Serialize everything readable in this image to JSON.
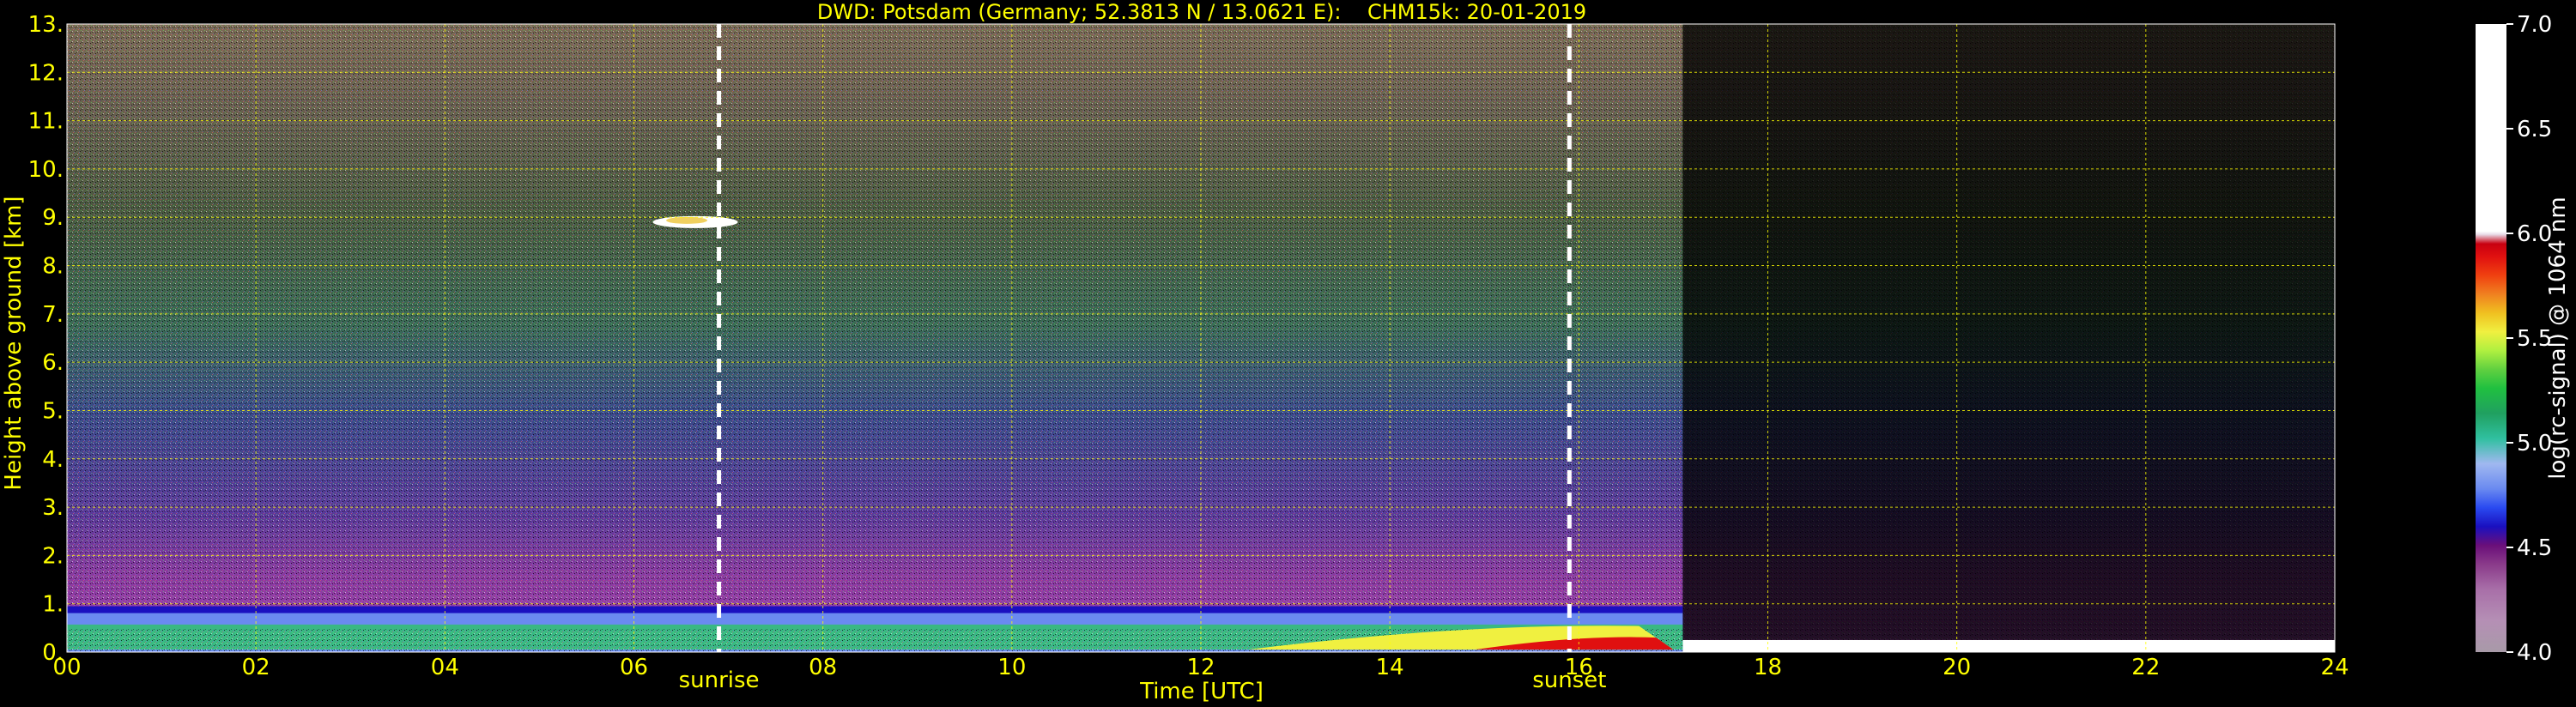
{
  "chart_data": {
    "type": "heatmap",
    "title": "DWD: Potsdam (Germany; 52.3813 N / 13.0621 E):    CHM15k: 20-01-2019",
    "xlabel": "Time [UTC]",
    "ylabel": "Height above ground [km]",
    "xlim": [
      0,
      24
    ],
    "ylim": [
      0,
      13
    ],
    "x_ticks": [
      {
        "value": 0,
        "label": "00"
      },
      {
        "value": 2,
        "label": "02"
      },
      {
        "value": 4,
        "label": "04"
      },
      {
        "value": 6,
        "label": "06"
      },
      {
        "value": 8,
        "label": "08"
      },
      {
        "value": 10,
        "label": "10"
      },
      {
        "value": 12,
        "label": "12"
      },
      {
        "value": 14,
        "label": "14"
      },
      {
        "value": 16,
        "label": "16"
      },
      {
        "value": 18,
        "label": "18"
      },
      {
        "value": 20,
        "label": "20"
      },
      {
        "value": 22,
        "label": "22"
      },
      {
        "value": 24,
        "label": "24"
      }
    ],
    "y_ticks": [
      {
        "value": 0,
        "label": "0."
      },
      {
        "value": 1,
        "label": "1."
      },
      {
        "value": 2,
        "label": "2."
      },
      {
        "value": 3,
        "label": "3."
      },
      {
        "value": 4,
        "label": "4."
      },
      {
        "value": 5,
        "label": "5."
      },
      {
        "value": 6,
        "label": "6."
      },
      {
        "value": 7,
        "label": "7."
      },
      {
        "value": 8,
        "label": "8."
      },
      {
        "value": 9,
        "label": "9."
      },
      {
        "value": 10,
        "label": "10."
      },
      {
        "value": 11,
        "label": "11."
      },
      {
        "value": 12,
        "label": "12."
      },
      {
        "value": 13,
        "label": "13."
      }
    ],
    "grid": true,
    "annotations": [
      {
        "label": "sunrise",
        "time": 6.9
      },
      {
        "label": "sunset",
        "time": 15.9
      }
    ],
    "features": [
      {
        "kind": "boundary-layer-band",
        "t_start": 0,
        "t_end": 17.1,
        "height_top": 0.95
      },
      {
        "kind": "cloud-patch",
        "t_start": 6.2,
        "t_end": 7.1,
        "height": 8.9
      },
      {
        "kind": "strong-backscatter-layer",
        "t_start": 12.5,
        "t_end": 17.0,
        "height_top": 0.6
      },
      {
        "kind": "low-signal-layer",
        "t_start": 17.1,
        "t_end": 24,
        "height_top": 0.25
      }
    ],
    "colorbar": {
      "label": "log(rc-signal) @ 1064 nm",
      "range": [
        4.0,
        7.0
      ],
      "ticks": [
        {
          "value": 4.0,
          "label": "4.0"
        },
        {
          "value": 4.5,
          "label": "4.5"
        },
        {
          "value": 5.0,
          "label": "5.0"
        },
        {
          "value": 5.5,
          "label": "5.5"
        },
        {
          "value": 6.0,
          "label": "6.0"
        },
        {
          "value": 6.5,
          "label": "6.5"
        },
        {
          "value": 7.0,
          "label": "7.0"
        }
      ],
      "colors": [
        "#a89aa8",
        "#b58fb5",
        "#a86fa8",
        "#8a3a8a",
        "#6a0f7a",
        "#1a10c0",
        "#2a4af0",
        "#6a8af0",
        "#8aa0f0",
        "#a0b8f0",
        "#30c0a0",
        "#20a060",
        "#20c040",
        "#60d040",
        "#b0f040",
        "#f0f040",
        "#f0c020",
        "#f08020",
        "#f04010",
        "#e01010",
        "#c80010",
        "#ffffff"
      ]
    }
  }
}
